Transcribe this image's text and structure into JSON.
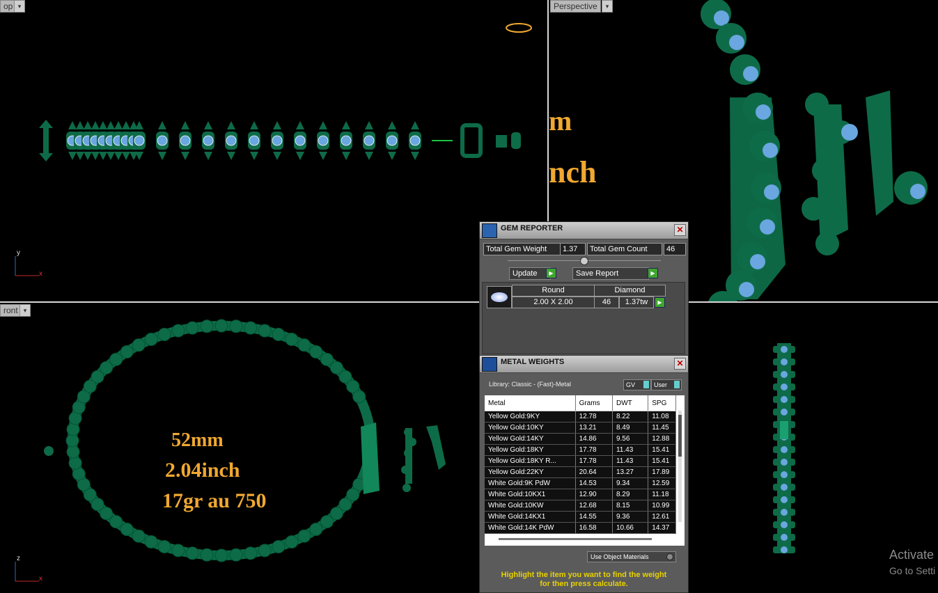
{
  "viewports": {
    "top": {
      "label": "op"
    },
    "perspective": {
      "label": "Perspective"
    },
    "front": {
      "label": "ront"
    },
    "top_axis": {
      "y": "y",
      "x": "x"
    },
    "front_axis": {
      "z": "z",
      "x": "x"
    }
  },
  "overlay": {
    "line1": "52mm",
    "line2": "2.04inch",
    "line3": "17gr au  750",
    "persp_m": "m",
    "persp_inch": "nch"
  },
  "gem_reporter": {
    "title": "GEM REPORTER",
    "total_weight_label": "Total Gem Weight",
    "total_weight_value": "1.37",
    "total_count_label": "Total Gem Count",
    "total_count_value": "46",
    "update_label": "Update",
    "save_report_label": "Save Report",
    "shape": "Round",
    "material": "Diamond",
    "size": "2.00 X 2.00",
    "count": "46",
    "carat": "1.37tw"
  },
  "metal_weights": {
    "title": "METAL WEIGHTS",
    "library": "Library: Classic - (Fast)-Metal",
    "gv_label": "GV",
    "user_label": "User",
    "columns": [
      "Metal",
      "Grams",
      "DWT",
      "SPG"
    ],
    "rows": [
      [
        "Yellow Gold:9KY",
        "12.78",
        "8.22",
        "11.08"
      ],
      [
        "Yellow Gold:10KY",
        "13.21",
        "8.49",
        "11.45"
      ],
      [
        "Yellow Gold:14KY",
        "14.86",
        "9.56",
        "12.88"
      ],
      [
        "Yellow Gold:18KY",
        "17.78",
        "11.43",
        "15.41"
      ],
      [
        "Yellow Gold:18KY R...",
        "17.78",
        "11.43",
        "15.41"
      ],
      [
        "Yellow Gold:22KY",
        "20.64",
        "13.27",
        "17.89"
      ],
      [
        "White Gold:9K PdW",
        "14.53",
        "9.34",
        "12.59"
      ],
      [
        "White Gold:10KX1",
        "12.90",
        "8.29",
        "11.18"
      ],
      [
        "White Gold:10KW",
        "12.68",
        "8.15",
        "10.99"
      ],
      [
        "White Gold:14KX1",
        "14.55",
        "9.36",
        "12.61"
      ],
      [
        "White Gold:14K PdW",
        "16.58",
        "10.66",
        "14.37"
      ]
    ],
    "use_object_materials": "Use Object Materials",
    "hint_line1": "Highlight the item you want to find the weight",
    "hint_line2": "for then press calculate."
  },
  "watermark": {
    "line1": "Activate",
    "line2": "Go to Setti"
  },
  "colors": {
    "metal_green": "#0e6b48",
    "gem_blue": "#6aa6e0",
    "gold_text": "#f0a830",
    "panel_bg": "#5b5b5b"
  }
}
